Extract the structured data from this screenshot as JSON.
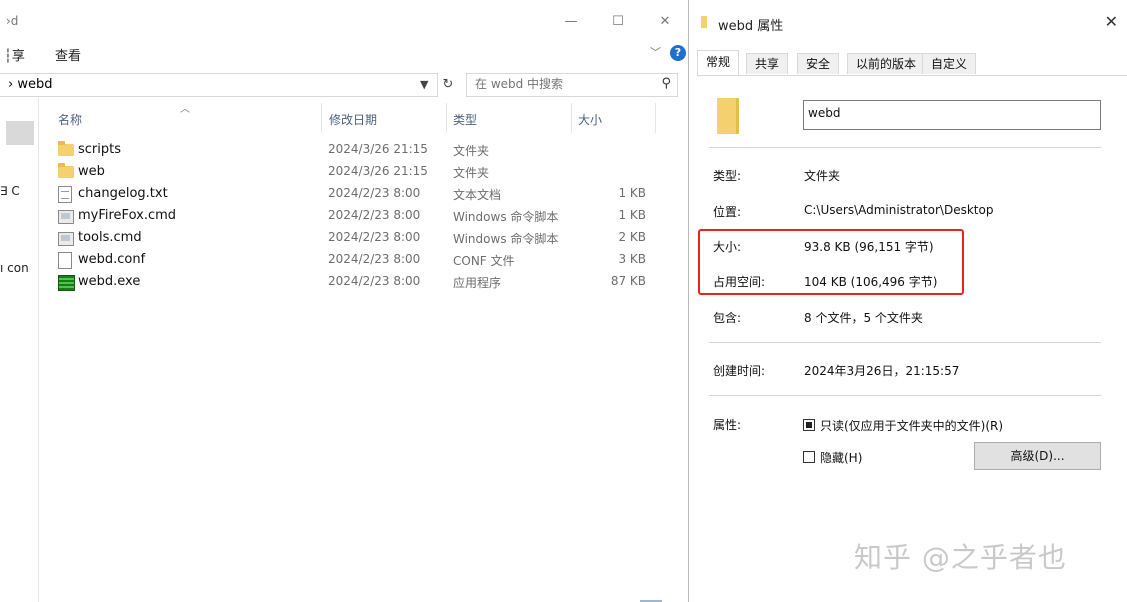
{
  "explorer": {
    "title_fragment": "›d",
    "window_buttons": {
      "minimize": "—",
      "maximize": "☐",
      "close": "✕"
    },
    "ribbon_tabs": [
      "共享",
      "查看"
    ],
    "ribbon_tab_first_visible": "┆享",
    "address": {
      "path": "›  webd"
    },
    "search": {
      "placeholder": "在 webd 中搜索"
    },
    "nav_fragments": [
      "∃ C",
      "ı con"
    ],
    "columns": {
      "name": "名称",
      "date": "修改日期",
      "type": "类型",
      "size": "大小"
    },
    "files": [
      {
        "icon": "folder-icon",
        "name": "scripts",
        "date": "2024/3/26 21:15",
        "type": "文件夹",
        "size": ""
      },
      {
        "icon": "folder-icon",
        "name": "web",
        "date": "2024/3/26 21:15",
        "type": "文件夹",
        "size": ""
      },
      {
        "icon": "text-file-icon",
        "name": "changelog.txt",
        "date": "2024/2/23 8:00",
        "type": "文本文档",
        "size": "1 KB"
      },
      {
        "icon": "cmd-file-icon",
        "name": "myFireFox.cmd",
        "date": "2024/2/23 8:00",
        "type": "Windows 命令脚本",
        "size": "1 KB"
      },
      {
        "icon": "cmd-file-icon",
        "name": "tools.cmd",
        "date": "2024/2/23 8:00",
        "type": "Windows 命令脚本",
        "size": "2 KB"
      },
      {
        "icon": "conf-file-icon",
        "name": "webd.conf",
        "date": "2024/2/23 8:00",
        "type": "CONF 文件",
        "size": "3 KB"
      },
      {
        "icon": "exe-file-icon",
        "name": "webd.exe",
        "date": "2024/2/23 8:00",
        "type": "应用程序",
        "size": "87 KB"
      }
    ]
  },
  "properties": {
    "title": "webd 属性",
    "close_glyph": "✕",
    "tabs": [
      "常规",
      "共享",
      "安全",
      "以前的版本",
      "自定义"
    ],
    "active_tab": "常规",
    "folder_name": "webd",
    "fields": {
      "type_label": "类型:",
      "type_value": "文件夹",
      "location_label": "位置:",
      "location_value": "C:\\Users\\Administrator\\Desktop",
      "size_label": "大小:",
      "size_value": "93.8 KB (96,151 字节)",
      "size_on_disk_label": "占用空间:",
      "size_on_disk_value": "104 KB (106,496 字节)",
      "contains_label": "包含:",
      "contains_value": "8 个文件，5 个文件夹",
      "created_label": "创建时间:",
      "created_value": "2024年3月26日，21:15:57",
      "attributes_label": "属性:"
    },
    "attributes": {
      "readonly_label": "只读(仅应用于文件夹中的文件)(R)",
      "readonly_checked": true,
      "hidden_label": "隐藏(H)",
      "hidden_checked": false,
      "advanced_button": "高级(D)..."
    },
    "highlight_color": "#e0281e"
  },
  "watermark": "知乎 @之乎者也"
}
